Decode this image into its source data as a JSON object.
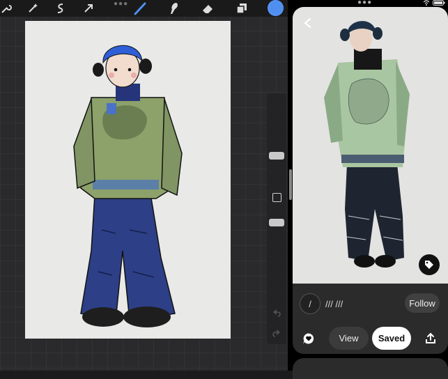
{
  "procreate": {
    "tools": [
      {
        "name": "wrench-icon"
      },
      {
        "name": "magic-wand-icon"
      },
      {
        "name": "selection-icon"
      },
      {
        "name": "transform-arrow-icon"
      },
      {
        "name": "brush-icon"
      },
      {
        "name": "smudge-icon"
      },
      {
        "name": "eraser-icon"
      },
      {
        "name": "layers-icon"
      }
    ],
    "current_color": "#4f8ff0"
  },
  "pin": {
    "board_initial": "/",
    "board_name": "/// ///",
    "follow_label": "Follow",
    "view_label": "View",
    "saved_label": "Saved"
  }
}
